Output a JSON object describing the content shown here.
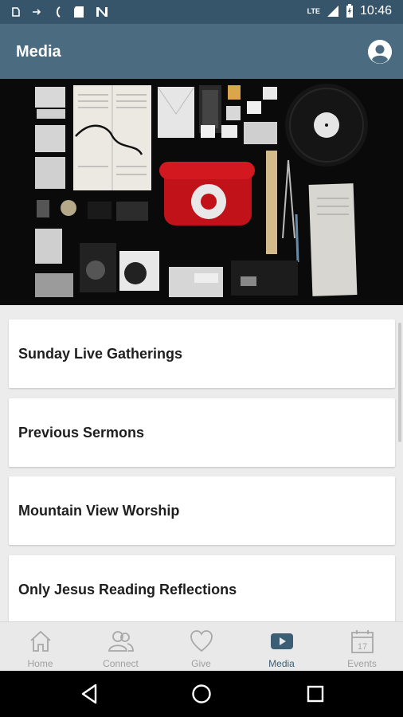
{
  "status_bar": {
    "time": "10:46",
    "network": "LTE",
    "icons": [
      "sim-icon",
      "signal-icon",
      "battery-icon"
    ]
  },
  "app_bar": {
    "title": "Media",
    "profile_icon": "person-circle-icon"
  },
  "hero": {
    "description_icon": "media-flatlay-image"
  },
  "media_list": {
    "items": [
      {
        "label": "Sunday Live Gatherings"
      },
      {
        "label": "Previous Sermons"
      },
      {
        "label": "Mountain View Worship"
      },
      {
        "label": "Only Jesus Reading Reflections"
      }
    ]
  },
  "tab_bar": {
    "tabs": [
      {
        "label": "Home",
        "icon": "home-icon",
        "active": false
      },
      {
        "label": "Connect",
        "icon": "people-icon",
        "active": false
      },
      {
        "label": "Give",
        "icon": "heart-icon",
        "active": false
      },
      {
        "label": "Media",
        "icon": "play-icon",
        "active": true
      },
      {
        "label": "Events",
        "icon": "calendar-icon",
        "active": false
      }
    ],
    "calendar_day": "17"
  },
  "colors": {
    "header": "#4a6b80",
    "status_bar": "#36556b",
    "active_tab": "#3b5e75",
    "inactive_tab": "#a0a0a0"
  }
}
